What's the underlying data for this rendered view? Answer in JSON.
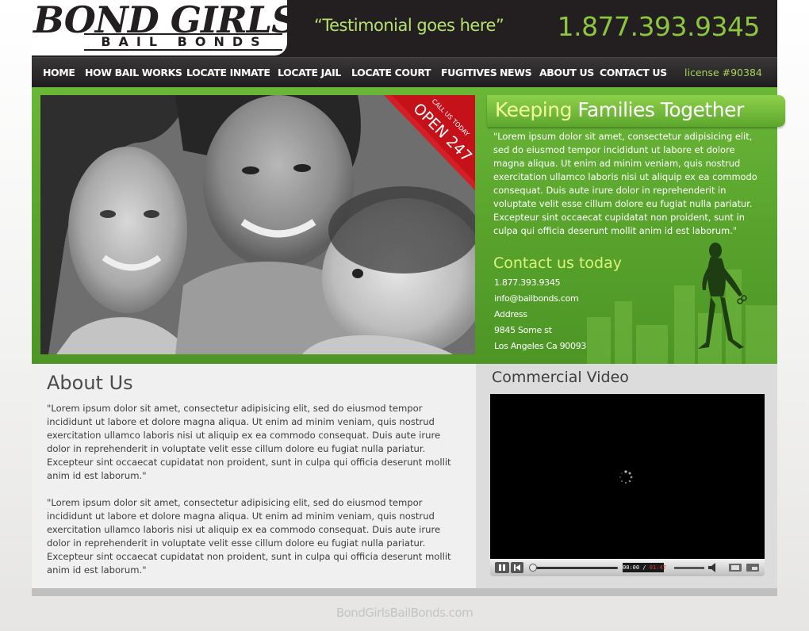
{
  "header": {
    "logo_main": "BOND GIRLS",
    "logo_sub": "BAIL BONDS",
    "testimonial": "“Testimonial goes here”",
    "phone": "1.877.393.9345"
  },
  "nav": {
    "items": [
      {
        "label": "HOME"
      },
      {
        "label": "HOW BAIL WORKS"
      },
      {
        "label": "LOCATE INMATE"
      },
      {
        "label": "LOCATE JAIL"
      },
      {
        "label": "LOCATE COURT"
      },
      {
        "label": "FUGITIVES"
      },
      {
        "label": "NEWS"
      },
      {
        "label": "ABOUT US"
      },
      {
        "label": "CONTACT US"
      }
    ],
    "license": "license #90384"
  },
  "hero": {
    "ribbon_small": "CALL US TODAY",
    "ribbon_big": "OPEN 247",
    "title_highlight": "Keeping",
    "title_rest": " Families Together",
    "body": "\"Lorem ipsum dolor sit amet, consectetur adipisicing elit, sed do eiusmod tempor incididunt ut labore et dolore magna aliqua. Ut enim ad minim veniam, quis nostrud exercitation ullamco laboris nisi ut aliquip ex ea commodo consequat. Duis aute irure dolor in reprehenderit in voluptate velit esse cillum dolore eu fugiat nulla pariatur. Excepteur sint occaecat cupidatat non proident, sunt in culpa qui officia deserunt mollit anim id est laborum.\"",
    "contact_heading": "Contact us today",
    "contact_lines": [
      "1.877.393.9345",
      "info@bailbonds.com",
      "Address",
      "9845 Some st",
      "Los Angeles Ca 90093"
    ]
  },
  "about": {
    "title": "About Us",
    "paragraphs": [
      "\"Lorem ipsum dolor sit amet, consectetur adipisicing elit, sed do eiusmod tempor incididunt ut labore et dolore magna aliqua. Ut enim ad minim veniam, quis nostrud exercitation ullamco laboris nisi ut aliquip ex ea commodo consequat. Duis aute irure dolor in reprehenderit in voluptate velit esse cillum dolore eu fugiat nulla pariatur. Excepteur sint occaecat cupidatat non proident, sunt in culpa qui officia deserunt mollit anim id est laborum.\"",
      "\"Lorem ipsum dolor sit amet, consectetur adipisicing elit, sed do eiusmod tempor incididunt ut labore et dolore magna aliqua. Ut enim ad minim veniam, quis nostrud exercitation ullamco laboris nisi ut aliquip ex ea commodo consequat. Duis aute irure dolor in reprehenderit in voluptate velit esse cillum dolore eu fugiat nulla pariatur. Excepteur sint occaecat cupidatat non proident, sunt in culpa qui officia deserunt mollit anim id est laborum.\""
    ]
  },
  "video": {
    "title": "Commercial Video",
    "time_current": "00:00",
    "time_total": "01:47"
  },
  "footer": {
    "text": "BondGirlsBailBonds.com"
  },
  "colors": {
    "header_bg": "#231f20",
    "accent_green": "#8cc63f",
    "hero_green": "#5aa52e",
    "ribbon_red": "#c4111a"
  },
  "icons": [
    "play-pause-icon",
    "stop-icon",
    "volume-icon",
    "fullscreen-icon",
    "popout-icon",
    "loading-spinner-icon"
  ]
}
